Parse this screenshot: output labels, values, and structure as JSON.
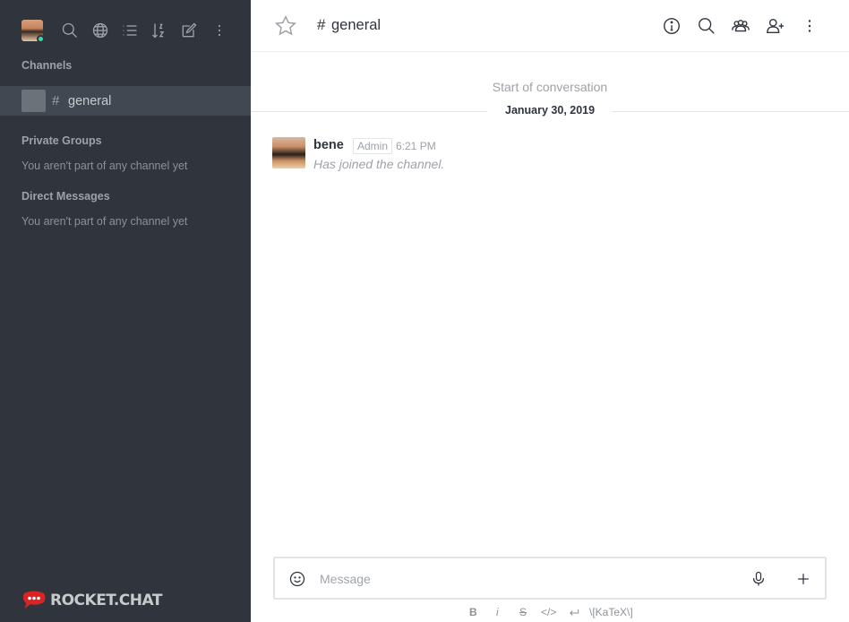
{
  "sidebar": {
    "sections": {
      "channels": "Channels",
      "private_groups": "Private Groups",
      "private_groups_empty": "You aren't part of any channel yet",
      "direct_messages": "Direct Messages",
      "direct_messages_empty": "You aren't part of any channel yet"
    },
    "channel_item": {
      "hash": "#",
      "name": "general"
    },
    "logo_text": "ROCKET.CHAT",
    "icons": [
      "search-icon",
      "globe-icon",
      "list-icon",
      "sort-icon",
      "compose-icon",
      "more-icon"
    ]
  },
  "header": {
    "hash": "#",
    "title": "general",
    "icons": [
      "star-icon",
      "info-icon",
      "search-icon",
      "members-icon",
      "add-user-icon",
      "kebab-icon"
    ]
  },
  "conversation": {
    "start_text": "Start of conversation",
    "date": "January 30, 2019",
    "messages": [
      {
        "user": "bene",
        "role": "Admin",
        "time": "6:21 PM",
        "text": "Has joined the channel."
      }
    ]
  },
  "composer": {
    "placeholder": "Message",
    "format": {
      "bold": "B",
      "italic": "i",
      "strike": "S",
      "code": "</>",
      "katex": "\\[KaTeX\\]"
    }
  },
  "colors": {
    "sidebar_bg": "#2f343d",
    "sidebar_active": "#414852",
    "status_online": "#2de0a5",
    "logo_red": "#db2323"
  }
}
